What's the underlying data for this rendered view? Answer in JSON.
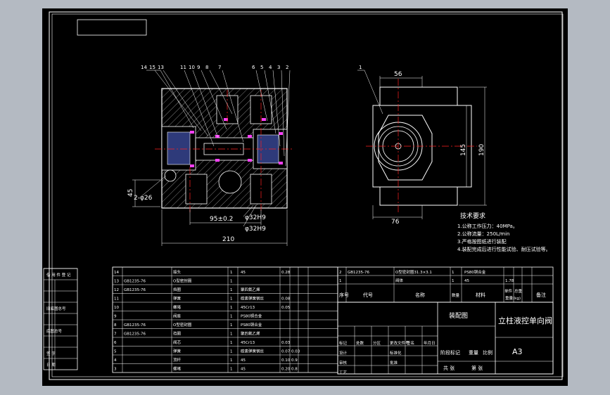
{
  "drawing": {
    "colors": {
      "outline": "#ffffff",
      "dimension": "#ffffff",
      "centerline": "#ff2020",
      "seal": "#ff40ff",
      "hatch": "#ffffff"
    },
    "front_view": {
      "balloons": [
        "14",
        "15",
        "13",
        "11",
        "10",
        "9",
        "8",
        "7",
        "6",
        "5",
        "4",
        "3",
        "2"
      ],
      "dims": {
        "width": "210",
        "spacing": "95±0.2",
        "height_left": "45",
        "bore_left": "2-φ26",
        "bore1": "φ32H9",
        "bore2": "φ32H9"
      }
    },
    "side_view": {
      "balloon": "1",
      "dims": {
        "top": "56",
        "bottom": "76",
        "h1": "145",
        "h2": "190"
      }
    },
    "notes": {
      "title": "技术要求",
      "lines": [
        "1.公称工作压力：40MPa。",
        "2.公称流量：250L/min",
        "3.严格按图纸进行装配",
        "4.装配完成后进行性能试验、耐压试验等。"
      ]
    },
    "revision_block": {
      "rows": [
        "借 用 件 登 记",
        "",
        "",
        "旧底图总号",
        "",
        "底图总号",
        "",
        "签 字",
        "日 期"
      ]
    },
    "bom": {
      "rows": [
        {
          "no": "14",
          "code": "",
          "name": "接头",
          "qty": "1",
          "material": "45",
          "weight": "0.28"
        },
        {
          "no": "13",
          "code": "GB1235-76",
          "name": "O型密封圈",
          "qty": "1",
          "material": "",
          "weight": ""
        },
        {
          "no": "12",
          "code": "GB1235-76",
          "name": "挡圈",
          "qty": "1",
          "material": "聚四氟乙烯",
          "weight": ""
        },
        {
          "no": "11",
          "code": "",
          "name": "弹簧",
          "qty": "1",
          "material": "碳素弹簧钢丝",
          "weight": "0.08"
        },
        {
          "no": "10",
          "code": "",
          "name": "螺堵",
          "qty": "1",
          "material": "45Cr13",
          "weight": "0.05"
        },
        {
          "no": "9",
          "code": "",
          "name": "阀座",
          "qty": "1",
          "material": "PS80铜合金",
          "weight": ""
        },
        {
          "no": "8",
          "code": "GB1235-76",
          "name": "O型密封圈",
          "qty": "1",
          "material": "PS80铜合金",
          "weight": ""
        },
        {
          "no": "7",
          "code": "GB1235-76",
          "name": "挡圈",
          "qty": "1",
          "material": "聚四氟乙烯",
          "weight": ""
        },
        {
          "no": "6",
          "code": "",
          "name": "阀芯",
          "qty": "1",
          "material": "45Cr13",
          "weight": "0.03"
        },
        {
          "no": "5",
          "code": "",
          "name": "弹簧",
          "qty": "1",
          "material": "碳素弹簧钢丝",
          "weight": "0.07"
        },
        {
          "no": "4",
          "code": "",
          "name": "顶杆",
          "qty": "1",
          "material": "45",
          "weight": "0.10"
        },
        {
          "no": "3",
          "code": "",
          "name": "螺堵",
          "qty": "1",
          "material": "45",
          "weight": "0.20"
        }
      ],
      "extra_weights": [
        "0.03",
        "0.9",
        "0.8"
      ],
      "right_rows": [
        {
          "no": "2",
          "code": "GB1235-76",
          "name": "O型密封圈31.3×3.1",
          "qty": "1",
          "material": "PS80铜合金",
          "weight": ""
        },
        {
          "no": "1",
          "code": "",
          "name": "阀体",
          "qty": "1",
          "material": "45",
          "weight": "1.78"
        }
      ],
      "header": {
        "seq": "序号",
        "code": "代号",
        "name": "名称",
        "qty": "数量",
        "material": "材料",
        "unit_weight": "单件",
        "total_weight": "总重",
        "weight_kg": "重量(kg)",
        "remark": "备注"
      }
    },
    "title_block": {
      "drawing_type": "装配图",
      "title": "立柱液控单向阀",
      "stage": "阶段标记",
      "weight": "重量",
      "scale": "比例",
      "sheet_total": "共 张",
      "sheet_no": "第 张",
      "size": "A3",
      "col_labels": [
        "标记",
        "处数",
        "分区",
        "更改文件号",
        "签名",
        "年月日"
      ],
      "roles": [
        "设计",
        "审核",
        "工艺"
      ],
      "roles2": [
        "标准化",
        "批准"
      ]
    }
  }
}
